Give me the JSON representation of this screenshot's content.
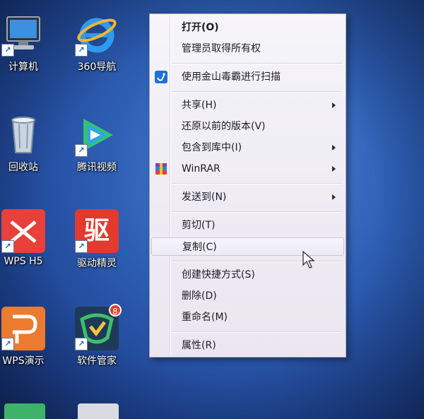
{
  "desktop_icons": [
    {
      "label": "计算机",
      "icon": "computer-icon"
    },
    {
      "label": "360导航",
      "icon": "ie-browser-icon"
    },
    {
      "label": "回收站",
      "icon": "recycle-bin-icon"
    },
    {
      "label": "腾讯视频",
      "icon": "tencent-video-icon"
    },
    {
      "label": "WPS H5",
      "icon": "wps-h5-icon"
    },
    {
      "label": "驱动精灵",
      "icon": "driver-genius-icon",
      "glyph": "驱"
    },
    {
      "label": "WPS演示",
      "icon": "wps-presentation-icon"
    },
    {
      "label": "软件管家",
      "icon": "software-manager-icon",
      "badge": "8"
    }
  ],
  "context_menu": {
    "items": [
      {
        "label": "打开(O)"
      },
      {
        "label": "管理员取得所有权"
      },
      {
        "label": "使用金山毒霸进行扫描",
        "icon": "kingsoft-antivirus-icon"
      },
      {
        "label": "共享(H)",
        "submenu": true
      },
      {
        "label": "还原以前的版本(V)"
      },
      {
        "label": "包含到库中(I)",
        "submenu": true
      },
      {
        "label": "WinRAR",
        "submenu": true,
        "icon": "winrar-icon"
      },
      {
        "label": "发送到(N)",
        "submenu": true
      },
      {
        "label": "剪切(T)"
      },
      {
        "label": "复制(C)"
      },
      {
        "label": "创建快捷方式(S)"
      },
      {
        "label": "删除(D)"
      },
      {
        "label": "重命名(M)"
      },
      {
        "label": "属性(R)"
      }
    ]
  },
  "colors": {
    "desktop_background": "#2e5fb5",
    "menu_background": "#f0eef5",
    "hover_item": "复制(C)"
  }
}
